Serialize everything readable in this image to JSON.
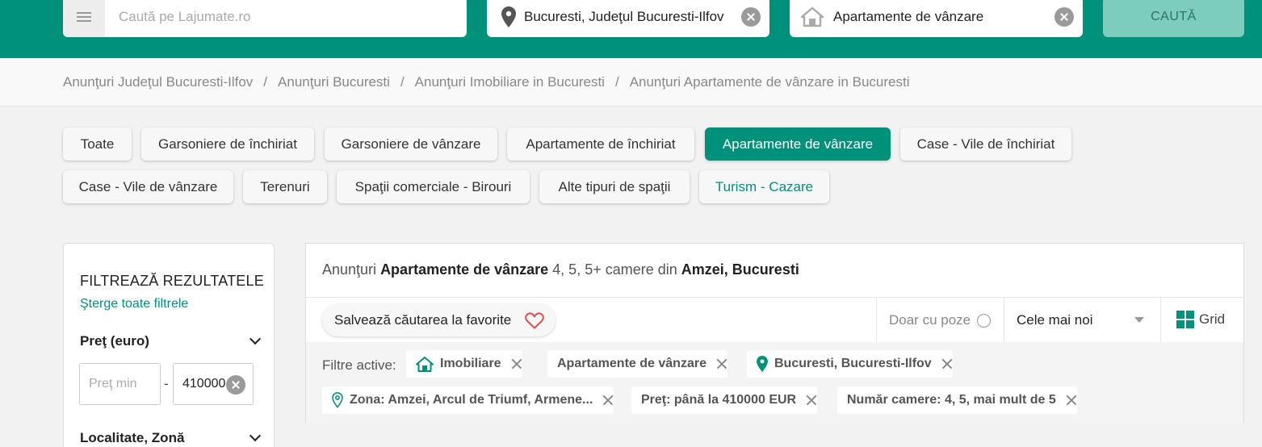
{
  "header": {
    "search_placeholder": "Caută pe Lajumate.ro",
    "location_value": "Bucuresti, Judeţul Bucuresti-Ilfov",
    "category_value": "Apartamente de vânzare",
    "search_button": "CAUTĂ",
    "brand_color": "#00917a"
  },
  "breadcrumb": {
    "items": [
      "Anunţuri Judeţul Bucuresti-Ilfov",
      "Anunţuri Bucuresti",
      "Anunţuri Imobiliare in Bucuresti",
      "Anunţuri Apartamente de vânzare in Bucuresti"
    ],
    "separator": "/"
  },
  "categories": [
    "Toate",
    "Garsoniere de închiriat",
    "Garsoniere de vânzare",
    "Apartamente de închiriat",
    "Apartamente de vânzare",
    "Case - Vile de închiriat",
    "Case - Vile de vânzare",
    "Terenuri",
    "Spaţii comerciale - Birouri",
    "Alte tipuri de spaţii",
    "Turism - Cazare"
  ],
  "sidebar": {
    "title": "FILTREAZĂ REZULTATELE",
    "clear_all": "Şterge toate filtrele",
    "price_heading": "Preţ (euro)",
    "price_min_placeholder": "Preţ min",
    "price_dash": "-",
    "price_max_value": "410000",
    "location_heading": "Localitate, Zonă"
  },
  "results": {
    "title_prefix": "Anunţuri",
    "title_category": "Apartamente de vânzare",
    "title_middle": "4, 5, 5+ camere din",
    "title_location": "Amzei, Bucuresti",
    "save_favorite": "Salvează căutarea la favorite",
    "photos_only": "Doar cu poze",
    "sort_value": "Cele mai noi",
    "view_mode": "Grid",
    "active_filters_label": "Filtre active:",
    "active_filters": [
      "Imobiliare",
      "Apartamente de vânzare",
      "Bucuresti, Bucuresti-Ilfov",
      "Zona: Amzei, Arcul de Triumf, Armene...",
      "Preţ: până la 410000 EUR",
      "Număr camere: 4, 5, mai mult de 5"
    ]
  }
}
